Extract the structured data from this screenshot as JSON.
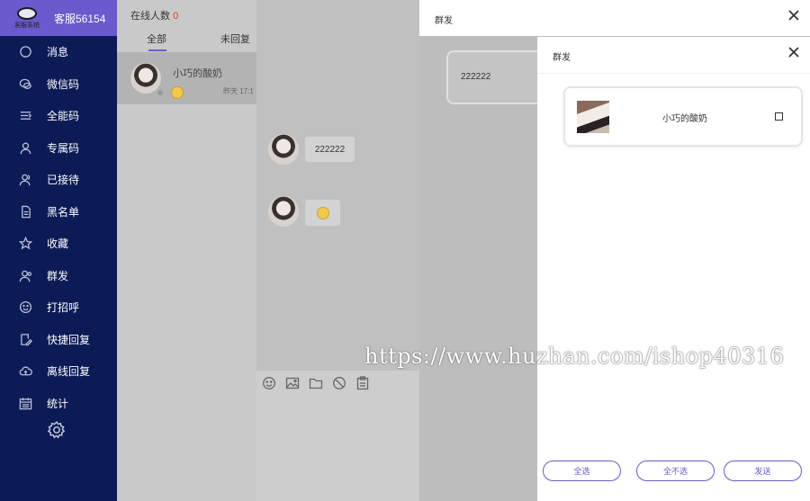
{
  "sidebar": {
    "logo_text": "客服系统",
    "agent_name": "客服56154",
    "items": [
      {
        "label": "消息",
        "icon": "chat-bubble-icon"
      },
      {
        "label": "微信码",
        "icon": "wechat-icon"
      },
      {
        "label": "全能码",
        "icon": "list-icon"
      },
      {
        "label": "专属码",
        "icon": "user-icon"
      },
      {
        "label": "已接待",
        "icon": "users-icon"
      },
      {
        "label": "黑名单",
        "icon": "document-icon"
      },
      {
        "label": "收藏",
        "icon": "star-icon"
      },
      {
        "label": "群发",
        "icon": "group-icon"
      },
      {
        "label": "打招呼",
        "icon": "smile-icon"
      },
      {
        "label": "快捷回复",
        "icon": "edit-icon"
      },
      {
        "label": "离线回复",
        "icon": "cloud-icon"
      },
      {
        "label": "统计",
        "icon": "calendar-icon"
      }
    ],
    "settings_icon": "gear-icon"
  },
  "conversation_list": {
    "online_label": "在线人数",
    "online_count": "0",
    "tabs": [
      {
        "label": "全部"
      },
      {
        "label": "未回复"
      }
    ],
    "items": [
      {
        "name": "小巧的酸奶",
        "time": "昨天 17:1",
        "preview": "emoji"
      }
    ]
  },
  "chat": {
    "messages": [
      {
        "type": "text",
        "text": "222222"
      },
      {
        "type": "emoji"
      }
    ],
    "toolbar": [
      "emoji-icon",
      "image-icon",
      "folder-icon",
      "block-icon",
      "clipboard-icon"
    ]
  },
  "modal_outer": {
    "title": "群发",
    "preview_text": "222222"
  },
  "modal_inner": {
    "title": "群发",
    "users": [
      {
        "name": "小巧的酸奶",
        "checked": false
      }
    ],
    "buttons": {
      "select_all": "全选",
      "select_none": "全不选",
      "send": "发送"
    }
  },
  "watermark": "https://www.huzhan.com/ishop40316",
  "colors": {
    "sidebar_bg": "#0c1b55",
    "sidebar_header": "#6a5acd",
    "accent": "#6a5acd",
    "online_count": "#e53935"
  }
}
